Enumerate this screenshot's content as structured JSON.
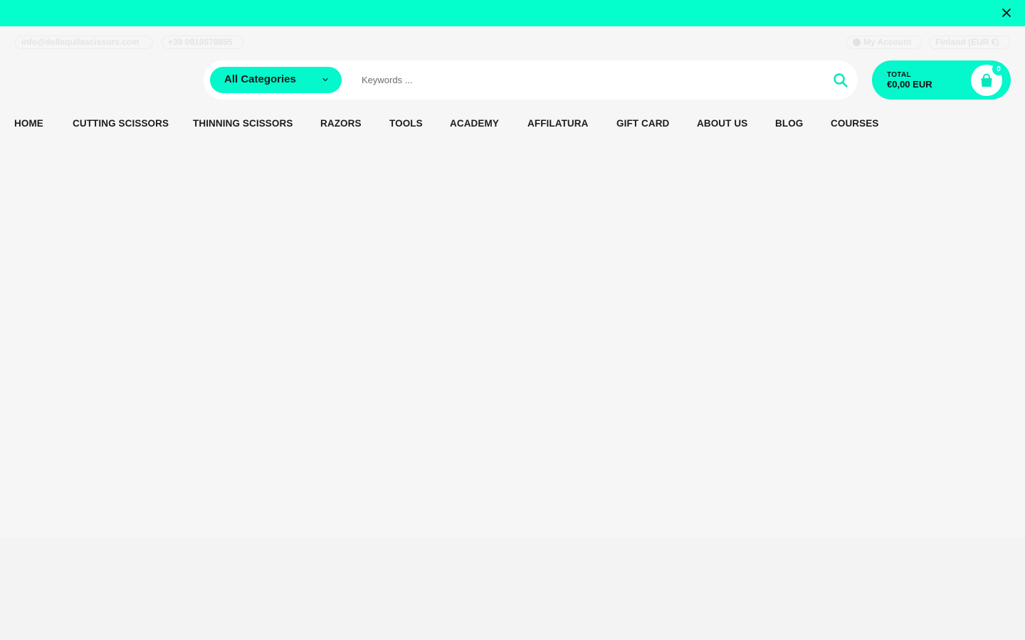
{
  "announcement": {
    "close_icon": "close-icon"
  },
  "top_bar": {
    "email": "info@dellaquilascissors.com",
    "phone": "+39 0810578855",
    "account": "My Account",
    "region": "Finland (EUR €)",
    "account_icon": "user-icon"
  },
  "search": {
    "category_label": "All Categories",
    "placeholder": "Keywords ...",
    "value": "",
    "search_icon": "search-icon"
  },
  "cart": {
    "total_label": "TOTAL",
    "total_value": "€0,00 EUR",
    "count": "0",
    "bag_icon": "shopping-bag-icon"
  },
  "nav": {
    "items": [
      {
        "label": "HOME"
      },
      {
        "label": "CUTTING SCISSORS"
      },
      {
        "label": "THINNING SCISSORS"
      },
      {
        "label": "RAZORS"
      },
      {
        "label": "TOOLS"
      },
      {
        "label": "ACADEMY"
      },
      {
        "label": "AFFILATURA"
      },
      {
        "label": "GIFT CARD"
      },
      {
        "label": "ABOUT US"
      },
      {
        "label": "BLOG"
      },
      {
        "label": "COURSES"
      }
    ]
  },
  "colors": {
    "accent": "#05ffcc",
    "background": "#f6f6f6",
    "text": "#1c1c1c"
  }
}
